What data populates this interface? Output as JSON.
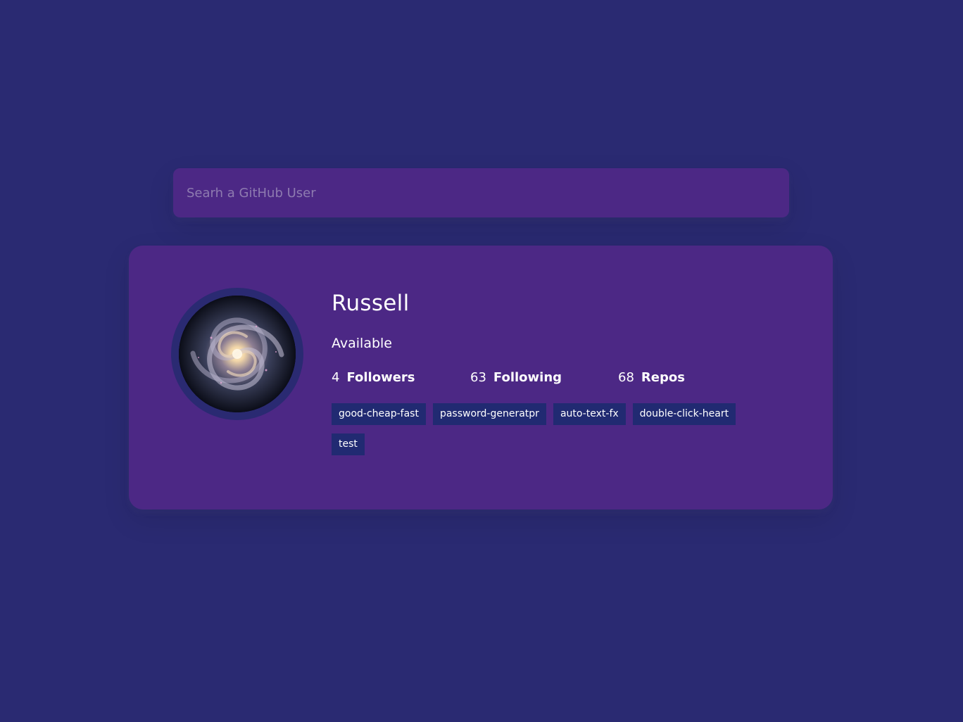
{
  "search": {
    "placeholder": "Searh a GitHub User",
    "value": ""
  },
  "profile": {
    "name": "Russell",
    "bio": "Available",
    "avatar_icon": "galaxy-avatar",
    "stats": {
      "followers": {
        "count": "4",
        "label": "Followers"
      },
      "following": {
        "count": "63",
        "label": "Following"
      },
      "repos": {
        "count": "68",
        "label": "Repos"
      }
    },
    "repos": [
      "good-cheap-fast",
      "password-generatpr",
      "auto-text-fx",
      "double-click-heart",
      "test"
    ]
  },
  "colors": {
    "background": "#2a2a72",
    "card": "#4c2885",
    "repo_badge": "#212a72",
    "text": "#ffffff"
  }
}
